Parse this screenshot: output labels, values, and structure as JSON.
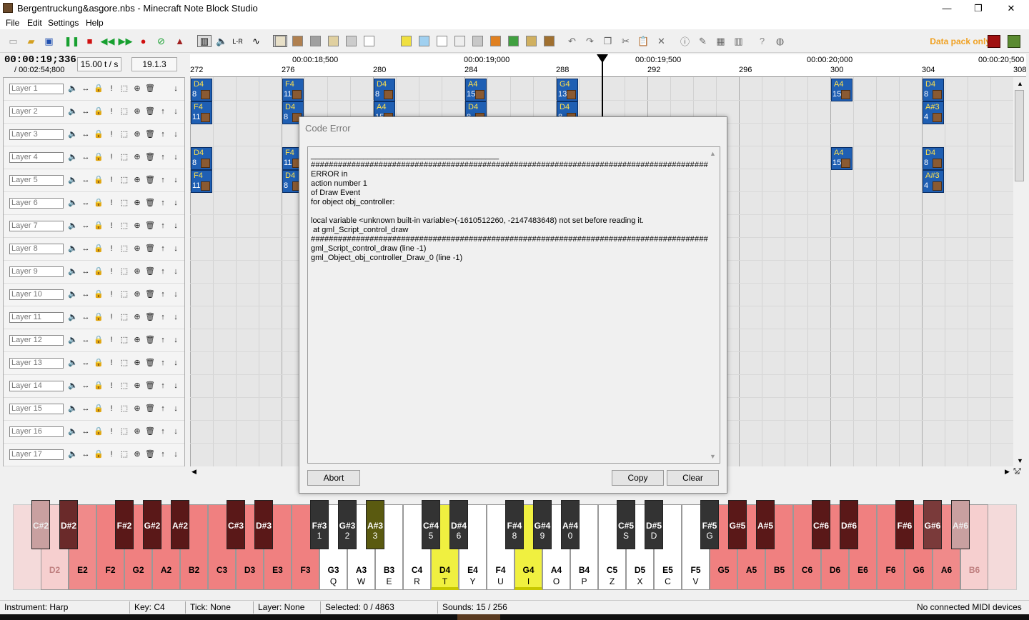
{
  "window": {
    "title": "Bergentruckung&asgore.nbs - Minecraft Note Block Studio",
    "minimize": "—",
    "maximize": "❐",
    "close": "✕"
  },
  "menu": [
    "File",
    "Edit",
    "Settings",
    "Help"
  ],
  "toolbar": {
    "datapack_label": "Data pack only",
    "accent_color": "#f0a020"
  },
  "playback": {
    "time": "00:00:19;336",
    "total": "/ 00:02:54;800",
    "tempo": "15.00 t / s",
    "version": "19.1.3"
  },
  "layers": [
    "Layer 1",
    "Layer 2",
    "Layer 3",
    "Layer 4",
    "Layer 5",
    "Layer 6",
    "Layer 7",
    "Layer 8",
    "Layer 9",
    "Layer 10",
    "Layer 11",
    "Layer 12",
    "Layer 13",
    "Layer 14",
    "Layer 15",
    "Layer 16",
    "Layer 17"
  ],
  "ruler": {
    "times": [
      "00:00:18;500",
      "00:00:19;000",
      "00:00:19;500",
      "00:00:20;000",
      "00:00:20;500"
    ],
    "ticks": [
      "272",
      "276",
      "280",
      "284",
      "288",
      "292",
      "296",
      "300",
      "304",
      "308"
    ]
  },
  "notes": [
    {
      "key": "D4",
      "vel": "8",
      "tick": 272,
      "layer": 1
    },
    {
      "key": "F4",
      "vel": "11",
      "tick": 272,
      "layer": 2
    },
    {
      "key": "D4",
      "vel": "8",
      "tick": 272,
      "layer": 4
    },
    {
      "key": "F4",
      "vel": "11",
      "tick": 272,
      "layer": 5
    },
    {
      "key": "F4",
      "vel": "11",
      "tick": 276,
      "layer": 1
    },
    {
      "key": "D4",
      "vel": "8",
      "tick": 276,
      "layer": 2
    },
    {
      "key": "F4",
      "vel": "11",
      "tick": 276,
      "layer": 4
    },
    {
      "key": "D4",
      "vel": "8",
      "tick": 276,
      "layer": 5
    },
    {
      "key": "D4",
      "vel": "8",
      "tick": 280,
      "layer": 1
    },
    {
      "key": "A4",
      "vel": "15",
      "tick": 280,
      "layer": 2
    },
    {
      "key": "A4",
      "vel": "15",
      "tick": 284,
      "layer": 1
    },
    {
      "key": "D4",
      "vel": "8",
      "tick": 284,
      "layer": 2
    },
    {
      "key": "G4",
      "vel": "13",
      "tick": 288,
      "layer": 1
    },
    {
      "key": "D4",
      "vel": "8",
      "tick": 288,
      "layer": 2
    },
    {
      "key": "A4",
      "vel": "15",
      "tick": 300,
      "layer": 1
    },
    {
      "key": "A4",
      "vel": "15",
      "tick": 300,
      "layer": 4
    },
    {
      "key": "D4",
      "vel": "8",
      "tick": 304,
      "layer": 1
    },
    {
      "key": "A#3",
      "vel": "4",
      "tick": 304,
      "layer": 2
    },
    {
      "key": "D4",
      "vel": "8",
      "tick": 304,
      "layer": 4
    },
    {
      "key": "A#3",
      "vel": "4",
      "tick": 304,
      "layer": 5
    }
  ],
  "dialog": {
    "title": "Code Error",
    "lines": [
      "___________________________________________",
      "####################################################################################################",
      "ERROR in",
      "action number 1",
      "of Draw Event",
      "for object obj_controller:",
      "",
      "local variable <unknown built-in variable>(-1610512260, -2147483648) not set before reading it.",
      " at gml_Script_control_draw",
      "####################################################################################################",
      "gml_Script_control_draw (line -1)",
      "gml_Object_obj_controller_Draw_0 (line -1)"
    ],
    "abort": "Abort",
    "copy": "Copy",
    "clear": "Clear"
  },
  "keyboard": {
    "white": [
      {
        "n": "D2",
        "l": "",
        "c": "#f6cfcf",
        "t": "#c08080"
      },
      {
        "n": "E2",
        "l": "",
        "c": "#f08a8a",
        "t": "#000"
      },
      {
        "n": "F2",
        "l": "",
        "c": "#f08080",
        "t": "#000"
      },
      {
        "n": "G2",
        "l": "",
        "c": "#f08080",
        "t": "#000"
      },
      {
        "n": "A2",
        "l": "",
        "c": "#f08080",
        "t": "#000"
      },
      {
        "n": "B2",
        "l": "",
        "c": "#f08080",
        "t": "#000"
      },
      {
        "n": "C3",
        "l": "",
        "c": "#f08080",
        "t": "#000"
      },
      {
        "n": "D3",
        "l": "",
        "c": "#f08080",
        "t": "#000"
      },
      {
        "n": "E3",
        "l": "",
        "c": "#f08080",
        "t": "#000"
      },
      {
        "n": "F3",
        "l": "",
        "c": "#f08080",
        "t": "#000"
      },
      {
        "n": "G3",
        "l": "Q",
        "c": "#ffffff",
        "t": "#000"
      },
      {
        "n": "A3",
        "l": "W",
        "c": "#ffffff",
        "t": "#000"
      },
      {
        "n": "B3",
        "l": "E",
        "c": "#ffffff",
        "t": "#000"
      },
      {
        "n": "C4",
        "l": "R",
        "c": "#ffffff",
        "t": "#000"
      },
      {
        "n": "D4",
        "l": "T",
        "c": "#f0f040",
        "t": "#000"
      },
      {
        "n": "E4",
        "l": "Y",
        "c": "#ffffff",
        "t": "#000"
      },
      {
        "n": "F4",
        "l": "U",
        "c": "#ffffff",
        "t": "#000"
      },
      {
        "n": "G4",
        "l": "I",
        "c": "#f0f040",
        "t": "#000"
      },
      {
        "n": "A4",
        "l": "O",
        "c": "#ffffff",
        "t": "#000"
      },
      {
        "n": "B4",
        "l": "P",
        "c": "#ffffff",
        "t": "#000"
      },
      {
        "n": "C5",
        "l": "Z",
        "c": "#ffffff",
        "t": "#000"
      },
      {
        "n": "D5",
        "l": "X",
        "c": "#ffffff",
        "t": "#000"
      },
      {
        "n": "E5",
        "l": "C",
        "c": "#ffffff",
        "t": "#000"
      },
      {
        "n": "F5",
        "l": "V",
        "c": "#ffffff",
        "t": "#000"
      },
      {
        "n": "G5",
        "l": "",
        "c": "#f08080",
        "t": "#000"
      },
      {
        "n": "A5",
        "l": "",
        "c": "#f08080",
        "t": "#000"
      },
      {
        "n": "B5",
        "l": "",
        "c": "#f08080",
        "t": "#000"
      },
      {
        "n": "C6",
        "l": "",
        "c": "#f08080",
        "t": "#000"
      },
      {
        "n": "D6",
        "l": "",
        "c": "#f08080",
        "t": "#000"
      },
      {
        "n": "E6",
        "l": "",
        "c": "#f08080",
        "t": "#000"
      },
      {
        "n": "F6",
        "l": "",
        "c": "#f08080",
        "t": "#000"
      },
      {
        "n": "G6",
        "l": "",
        "c": "#f08080",
        "t": "#000"
      },
      {
        "n": "A6",
        "l": "",
        "c": "#f08a8a",
        "t": "#000"
      },
      {
        "n": "B6",
        "l": "",
        "c": "#f6cfcf",
        "t": "#c08080"
      }
    ],
    "black": [
      {
        "n": "C#2",
        "l": "",
        "c": "#c9a0a0",
        "t": "#eee"
      },
      {
        "n": "D#2",
        "l": "",
        "c": "#6a2a2a",
        "t": "#fff"
      },
      {
        "n": "F#2",
        "l": "",
        "c": "#5a1818",
        "t": "#fff"
      },
      {
        "n": "G#2",
        "l": "",
        "c": "#5a1818",
        "t": "#fff"
      },
      {
        "n": "A#2",
        "l": "",
        "c": "#5a1818",
        "t": "#fff"
      },
      {
        "n": "C#3",
        "l": "",
        "c": "#5a1818",
        "t": "#fff"
      },
      {
        "n": "D#3",
        "l": "",
        "c": "#5a1818",
        "t": "#fff"
      },
      {
        "n": "F#3",
        "l": "1",
        "c": "#333333",
        "t": "#fff"
      },
      {
        "n": "G#3",
        "l": "2",
        "c": "#333333",
        "t": "#fff"
      },
      {
        "n": "A#3",
        "l": "3",
        "c": "#5a5a10",
        "t": "#fff"
      },
      {
        "n": "C#4",
        "l": "5",
        "c": "#333333",
        "t": "#fff"
      },
      {
        "n": "D#4",
        "l": "6",
        "c": "#333333",
        "t": "#fff"
      },
      {
        "n": "F#4",
        "l": "8",
        "c": "#333333",
        "t": "#fff"
      },
      {
        "n": "G#4",
        "l": "9",
        "c": "#333333",
        "t": "#fff"
      },
      {
        "n": "A#4",
        "l": "0",
        "c": "#333333",
        "t": "#fff"
      },
      {
        "n": "C#5",
        "l": "S",
        "c": "#333333",
        "t": "#fff"
      },
      {
        "n": "D#5",
        "l": "D",
        "c": "#333333",
        "t": "#fff"
      },
      {
        "n": "F#5",
        "l": "G",
        "c": "#333333",
        "t": "#fff"
      },
      {
        "n": "G#5",
        "l": "",
        "c": "#5a1818",
        "t": "#fff"
      },
      {
        "n": "A#5",
        "l": "",
        "c": "#5a1818",
        "t": "#fff"
      },
      {
        "n": "C#6",
        "l": "",
        "c": "#5a1818",
        "t": "#fff"
      },
      {
        "n": "D#6",
        "l": "",
        "c": "#5a1818",
        "t": "#fff"
      },
      {
        "n": "F#6",
        "l": "",
        "c": "#5a1818",
        "t": "#fff"
      },
      {
        "n": "G#6",
        "l": "",
        "c": "#7a3a3a",
        "t": "#fff"
      },
      {
        "n": "A#6",
        "l": "",
        "c": "#c9a0a0",
        "t": "#eee"
      }
    ]
  },
  "status": {
    "instrument": "Instrument: Harp",
    "key": "Key: C4",
    "tick": "Tick: None",
    "layer": "Layer: None",
    "selected": "Selected: 0 / 4863",
    "sounds": "Sounds: 15 / 256",
    "midi": "No connected MIDI devices"
  }
}
